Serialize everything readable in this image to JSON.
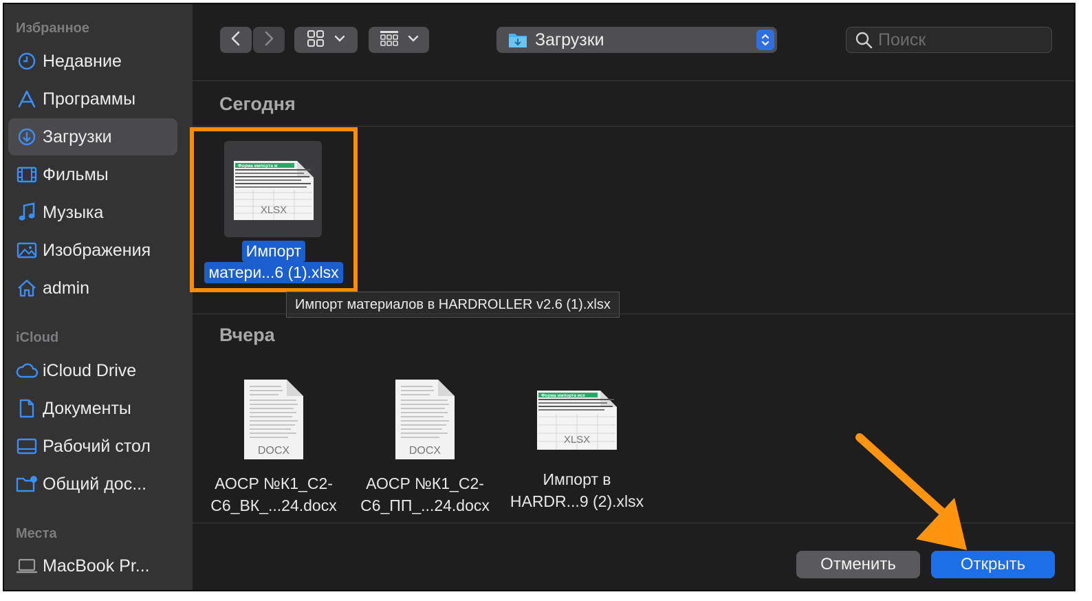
{
  "sidebar": {
    "favorites_title": "Избранное",
    "favorites": [
      {
        "label": "Недавние",
        "icon": "clock-icon"
      },
      {
        "label": "Программы",
        "icon": "apps-icon"
      },
      {
        "label": "Загрузки",
        "icon": "download-icon",
        "active": true
      },
      {
        "label": "Фильмы",
        "icon": "film-icon"
      },
      {
        "label": "Музыка",
        "icon": "music-note-icon"
      },
      {
        "label": "Изображения",
        "icon": "pictures-icon"
      },
      {
        "label": "admin",
        "icon": "home-icon"
      }
    ],
    "icloud_title": "iCloud",
    "icloud": [
      {
        "label": "iCloud Drive",
        "icon": "cloud-icon"
      },
      {
        "label": "Документы",
        "icon": "document-icon"
      },
      {
        "label": "Рабочий стол",
        "icon": "desktop-icon"
      },
      {
        "label": "Общий дос...",
        "icon": "shared-folder-icon"
      }
    ],
    "locations_title": "Места",
    "locations": [
      {
        "label": "MacBook Pr...",
        "icon": "laptop-icon"
      }
    ]
  },
  "toolbar": {
    "path_label": "Загрузки",
    "search_placeholder": "Поиск"
  },
  "groups": {
    "today_title": "Сегодня",
    "yesterday_title": "Вчера"
  },
  "selected_file": {
    "line1": "Импорт",
    "line2": "матери...6 (1).xlsx",
    "thumb_label": "XLSX",
    "thumb_header": "Форма импорта ж",
    "tooltip": "Импорт материалов в HARDROLLER v2.6 (1).xlsx"
  },
  "yesterday_files": [
    {
      "line1": "АОСР №К1_С2-",
      "line2": "С6_ВК_...24.docx",
      "thumb_label": "DOCX"
    },
    {
      "line1": "АОСР №К1_С2-",
      "line2": "С6_ПП_...24.docx",
      "thumb_label": "DOCX"
    },
    {
      "line1": "Импорт в",
      "line2": "HARDR...9 (2).xlsx",
      "thumb_label": "XLSX",
      "thumb_header": "Форма импорта исх"
    }
  ],
  "buttons": {
    "cancel": "Отменить",
    "open": "Открыть"
  },
  "colors": {
    "accent": "#1c6fe6",
    "highlight": "#ff8c00",
    "sidebar_icon": "#3a8ef6"
  }
}
